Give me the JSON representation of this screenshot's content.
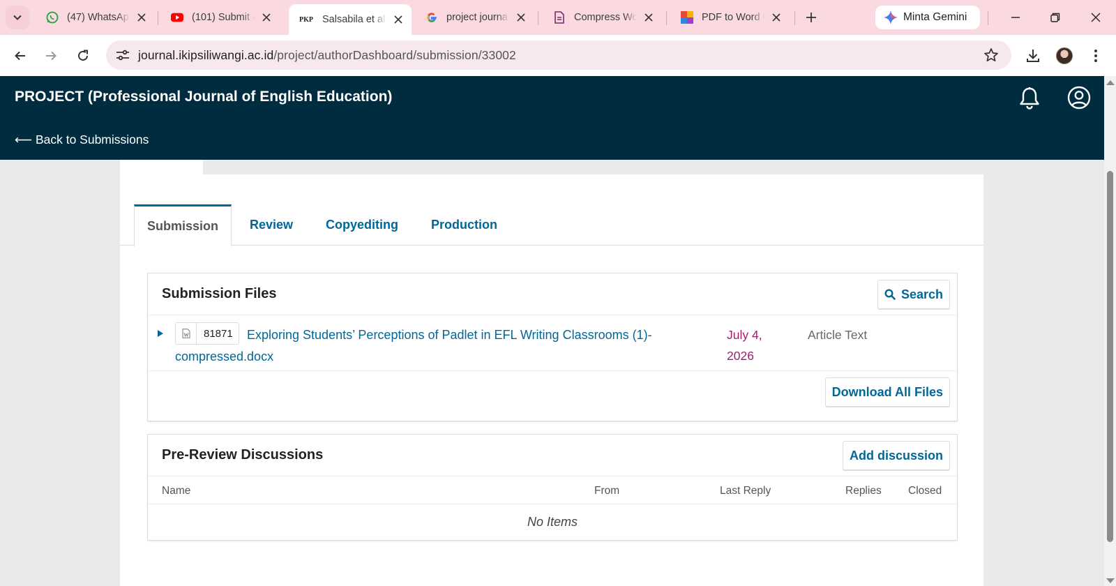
{
  "browser": {
    "tabs": [
      {
        "title": "(47) WhatsApp",
        "icon": "whatsapp-icon"
      },
      {
        "title": "(101) Submit a",
        "icon": "youtube-icon"
      },
      {
        "title": "Salsabila et al.",
        "icon": "pkp-icon",
        "active": true
      },
      {
        "title": "project journa",
        "icon": "google-icon"
      },
      {
        "title": "Compress Wo",
        "icon": "document-icon"
      },
      {
        "title": "PDF to Word C",
        "icon": "pdf-to-word-icon"
      }
    ],
    "pkp_favicon_text": "PKP",
    "gemini_label": "Minta Gemini",
    "url_host": "journal.ikipsiliwangi.ac.id",
    "url_path": "/project/authorDashboard/submission/33002",
    "tabstrip_color": "#fbd9e1"
  },
  "header": {
    "site_title": "PROJECT (Professional Journal of English Education)",
    "back_label": "⟵ Back to Submissions",
    "bg_color": "#002c40"
  },
  "workflow_tabs": [
    {
      "label": "Submission",
      "current": true
    },
    {
      "label": "Review"
    },
    {
      "label": "Copyediting"
    },
    {
      "label": "Production"
    }
  ],
  "submission_files": {
    "title": "Submission Files",
    "search_label": "Search",
    "files": [
      {
        "id": "81871",
        "name": "Exploring Students’ Perceptions of Padlet in EFL Writing Classrooms (1)-compressed.docx",
        "date": "July 4, 2026",
        "type": "Article Text"
      }
    ],
    "download_all_label": "Download All Files"
  },
  "discussions": {
    "title": "Pre-Review Discussions",
    "add_label": "Add discussion",
    "columns": [
      "Name",
      "From",
      "Last Reply",
      "Replies",
      "Closed"
    ],
    "empty_text": "No Items"
  },
  "colors": {
    "link": "#006798",
    "date": "#a11d6c"
  }
}
